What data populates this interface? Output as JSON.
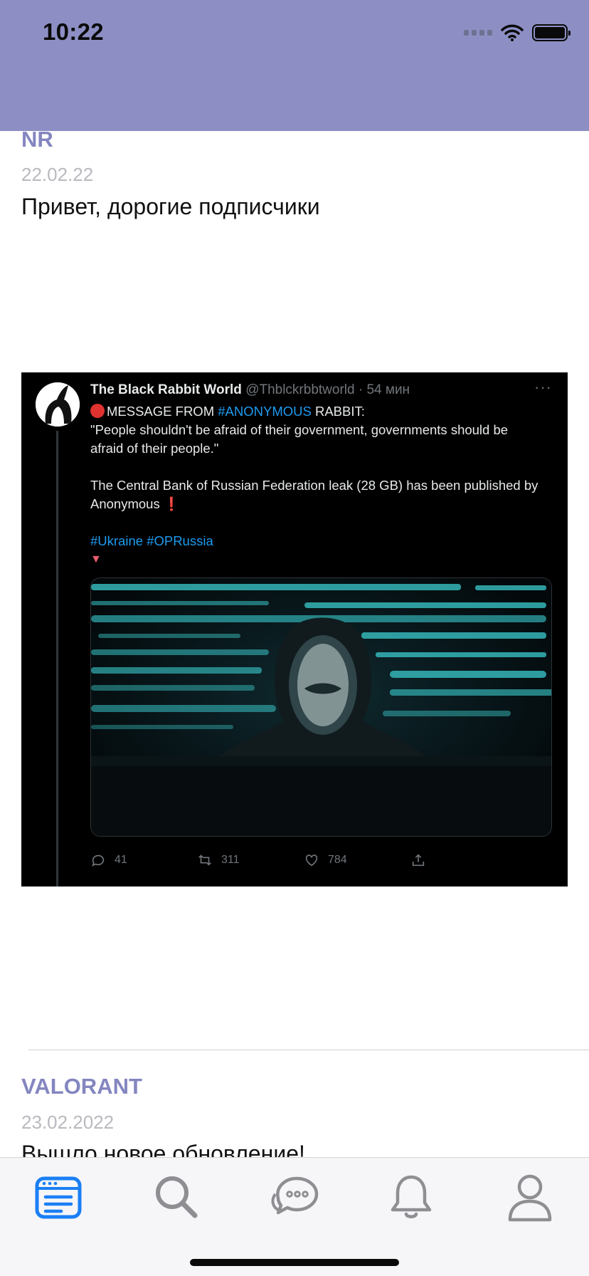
{
  "status_bar": {
    "time": "10:22",
    "icons": [
      "signal-icon",
      "wifi-icon",
      "battery-icon"
    ]
  },
  "colors": {
    "header": "#8d8fc4",
    "author": "#8486c0",
    "date": "#b9b9bf",
    "tab_active": "#1a7ff5",
    "tab_inactive": "#8e8e93"
  },
  "feed": {
    "posts": [
      {
        "author": "NR",
        "date": "22.02.22",
        "text": "Привет, дорогие подписчики",
        "image": {
          "tweet_name": "The Black Rabbit World",
          "tweet_handle": "@Thblckrbbtworld · 54 мин",
          "line1_pre": "MESSAGE FROM ",
          "line1_tag": "#ANONYMOUS",
          "line1_post": " RABBIT:",
          "quote_1": "\"People shouldn't be afraid of their government, governments should be",
          "quote_2": "afraid of their people.\"",
          "leak_1": "The Central Bank of Russian Federation leak (28 GB) has been published by",
          "leak_2": "Anonymous",
          "hashtags": "#Ukraine #OPRussia",
          "replies": "41",
          "retweets": "311",
          "likes": "784"
        }
      },
      {
        "author": "VALORANT",
        "date": "23.02.2022",
        "text": "Вышло новое обновление!"
      }
    ]
  },
  "tabbar": {
    "items": [
      {
        "icon": "news-feed-icon",
        "active": true
      },
      {
        "icon": "search-icon",
        "active": false
      },
      {
        "icon": "chat-icon",
        "active": false
      },
      {
        "icon": "bell-icon",
        "active": false
      },
      {
        "icon": "profile-icon",
        "active": false
      }
    ]
  }
}
